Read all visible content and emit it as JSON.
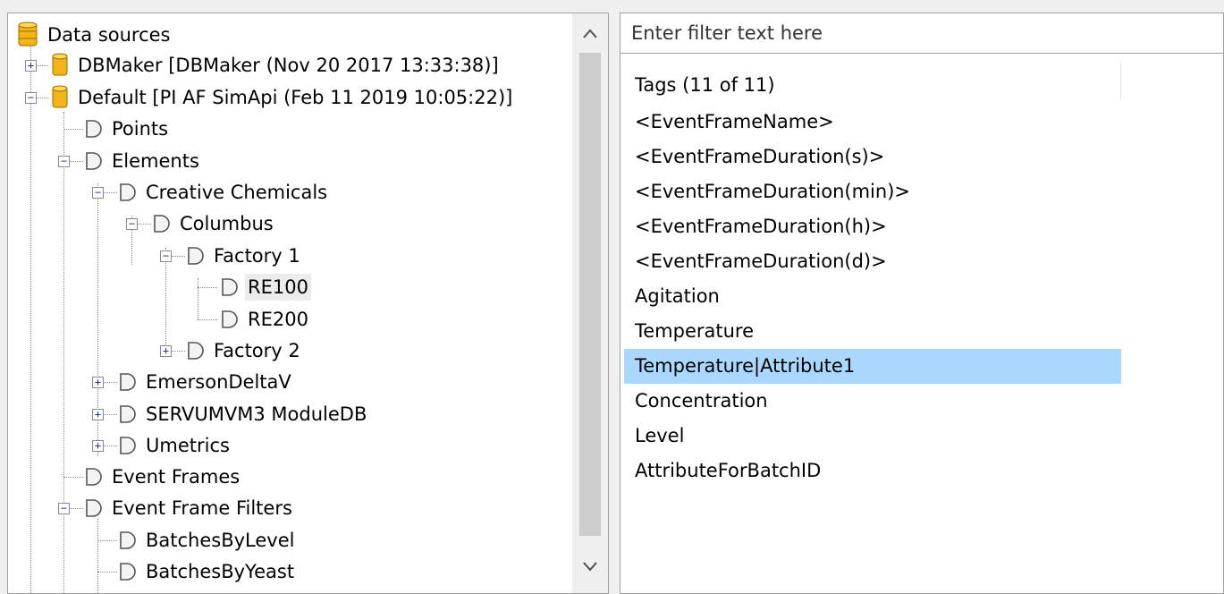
{
  "tree": {
    "root_label": "Data sources",
    "nodes": [
      {
        "label": "DBMaker [DBMaker (Nov 20 2017 13:33:38)]"
      },
      {
        "label": "Default [PI AF SimApi (Feb 11 2019 10:05:22)]"
      },
      {
        "label": "Points"
      },
      {
        "label": "Elements"
      },
      {
        "label": "Creative Chemicals"
      },
      {
        "label": "Columbus"
      },
      {
        "label": "Factory 1"
      },
      {
        "label": "RE100"
      },
      {
        "label": "RE200"
      },
      {
        "label": "Factory 2"
      },
      {
        "label": "EmersonDeltaV"
      },
      {
        "label": "SERVUMVM3 ModuleDB"
      },
      {
        "label": "Umetrics"
      },
      {
        "label": "Event Frames"
      },
      {
        "label": "Event Frame Filters"
      },
      {
        "label": "BatchesByLevel"
      },
      {
        "label": "BatchesByYeast"
      }
    ]
  },
  "filter": {
    "placeholder": "Enter filter text here",
    "value": ""
  },
  "tags": {
    "header": "Tags (11 of 11)",
    "items": [
      "<EventFrameName>",
      "<EventFrameDuration(s)>",
      "<EventFrameDuration(min)>",
      "<EventFrameDuration(h)>",
      "<EventFrameDuration(d)>",
      "Agitation",
      "Temperature",
      "Temperature|Attribute1",
      "Concentration",
      "Level",
      "AttributeForBatchID"
    ],
    "selected": "Temperature|Attribute1"
  },
  "colors": {
    "selection": "#aad8ff",
    "hover": "#ececec",
    "database_icon": "#f2b416"
  }
}
